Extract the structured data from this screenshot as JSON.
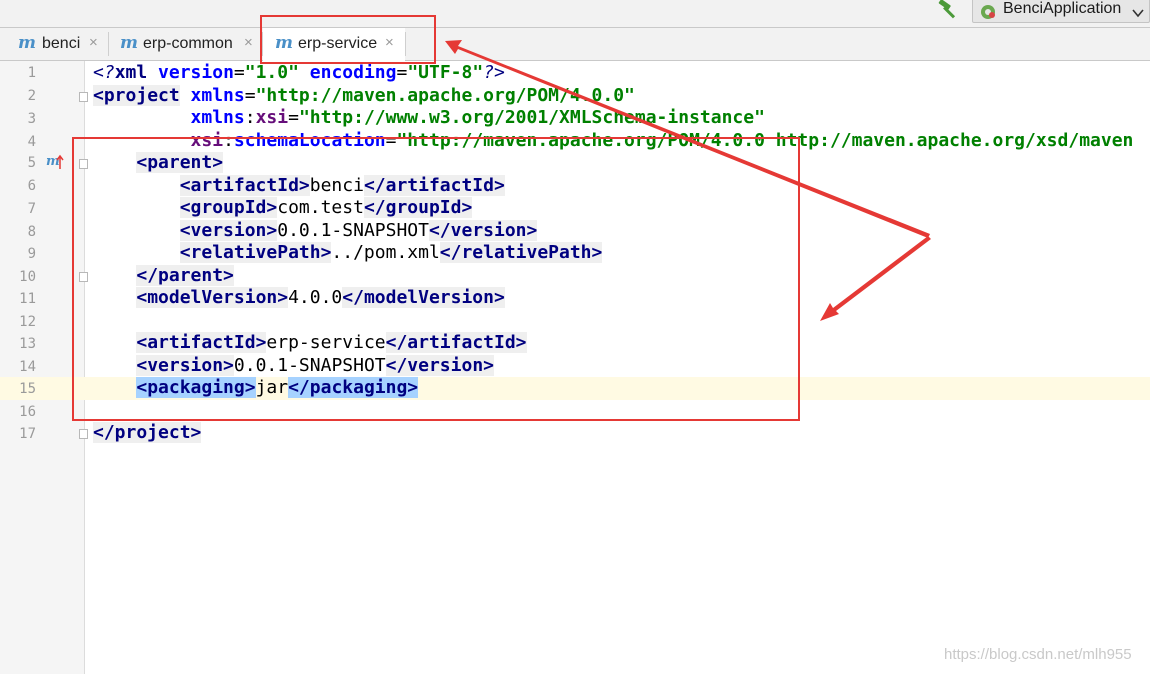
{
  "toolbar": {
    "run_config_label": "BenciApplication",
    "icons": [
      "hammer-icon",
      "spring-boot-icon",
      "chevron-down-icon"
    ]
  },
  "tabs": [
    {
      "prefix": "m",
      "label": "benci",
      "close": "×",
      "active": false
    },
    {
      "prefix": "m",
      "label": "erp-common",
      "close": "×",
      "active": false
    },
    {
      "prefix": "m",
      "label": "erp-service",
      "close": "×",
      "active": true
    }
  ],
  "line_numbers": [
    "1",
    "2",
    "3",
    "4",
    "5",
    "6",
    "7",
    "8",
    "9",
    "10",
    "11",
    "12",
    "13",
    "14",
    "15",
    "16",
    "17"
  ],
  "gutter_marker": "m",
  "code": {
    "l1": {
      "open": "<?",
      "xml": "xml",
      "attr1": "version",
      "eq": "=",
      "val1": "\"1.0\"",
      "attr2": "encoding",
      "val2": "\"UTF-8\"",
      "close": "?>"
    },
    "l2": {
      "lt": "<",
      "tag": "project",
      "attr": "xmlns",
      "eq": "=",
      "val": "\"http://maven.apache.org/POM/4.0.0\""
    },
    "l3": {
      "attr_ns": "xmlns",
      "colon": ":",
      "attr_local": "xsi",
      "eq": "=",
      "val": "\"http://www.w3.org/2001/XMLSchema-instance\""
    },
    "l4": {
      "attr_ns": "xsi",
      "colon": ":",
      "attr_local": "schemaLocation",
      "eq": "=",
      "val": "\"http://maven.apache.org/POM/4.0.0 http://maven.apache.org/xsd/maven"
    },
    "l5": {
      "open": "<parent>"
    },
    "l6": {
      "open": "<artifactId>",
      "text": "benci",
      "close": "</artifactId>"
    },
    "l7": {
      "open": "<groupId>",
      "text": "com.test",
      "close": "</groupId>"
    },
    "l8": {
      "open": "<version>",
      "text": "0.0.1-SNAPSHOT",
      "close": "</version>"
    },
    "l9": {
      "open": "<relativePath>",
      "text": "../pom.xml",
      "close": "</relativePath>"
    },
    "l10": {
      "close": "</parent>"
    },
    "l11": {
      "open": "<modelVersion>",
      "text": "4.0.0",
      "close": "</modelVersion>"
    },
    "l13": {
      "open": "<artifactId>",
      "text": "erp-service",
      "close": "</artifactId>"
    },
    "l14": {
      "open": "<version>",
      "text": "0.0.1-SNAPSHOT",
      "close": "</version>"
    },
    "l15": {
      "open": "<packaging>",
      "text": "jar",
      "close": "</packaging>"
    },
    "l17": {
      "close": "</project>"
    }
  },
  "watermark": "https://blog.csdn.net/mlh955",
  "colors": {
    "annotation": "#e53935",
    "tag": "#000080",
    "attribute": "#0000ff",
    "value": "#008000",
    "selection": "#a6d2ff",
    "caret_row": "#fffae3"
  }
}
